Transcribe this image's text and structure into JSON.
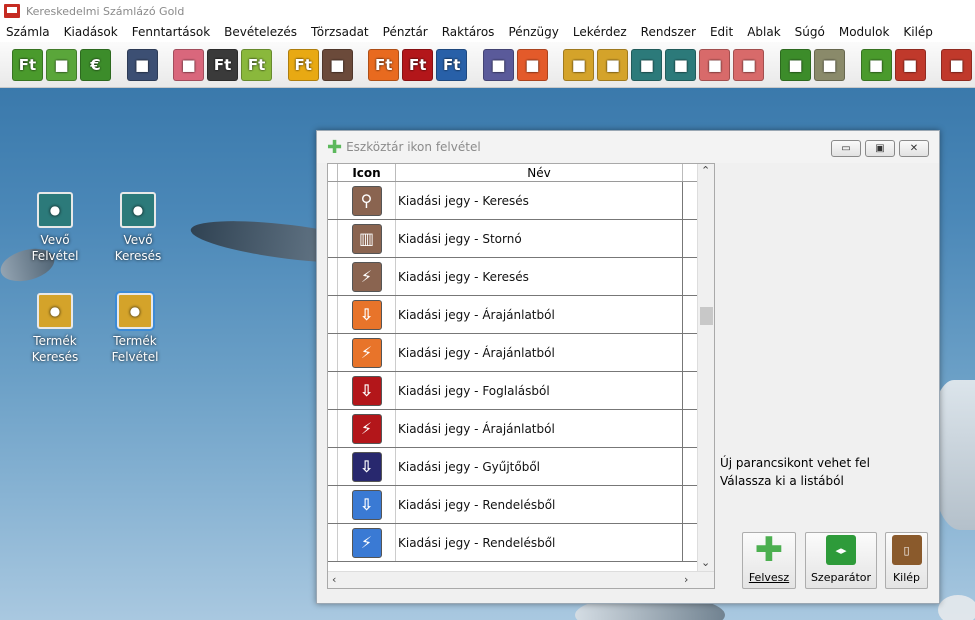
{
  "app": {
    "title": "Kereskedelmi Számlázó Gold"
  },
  "menu": [
    "Számla",
    "Kiadások",
    "Fenntartások",
    "Bevételezés",
    "Törzsadat",
    "Pénztár",
    "Raktáros",
    "Pénzügy",
    "Lekérdez",
    "Rendszer",
    "Edit",
    "Ablak",
    "Súgó",
    "Modulok",
    "Kilép"
  ],
  "toolbar": {
    "buttons": [
      {
        "icon": "forint-icon",
        "text": "Ft",
        "color": "#4a9a2c"
      },
      {
        "icon": "invoice-icon",
        "text": "",
        "color": "#5aa63a"
      },
      {
        "icon": "euro-icon",
        "text": "€",
        "color": "#3c8c2a"
      },
      {
        "icon": "gap"
      },
      {
        "icon": "printer-icon",
        "text": "",
        "color": "#3c4f73"
      },
      {
        "icon": "gap"
      },
      {
        "icon": "print-preview-icon",
        "text": "",
        "color": "#d9677c"
      },
      {
        "icon": "forint-dark-icon",
        "text": "Ft",
        "color": "#3a3a3a"
      },
      {
        "icon": "forint-green-icon",
        "text": "Ft",
        "color": "#8ab83c"
      },
      {
        "icon": "gap"
      },
      {
        "icon": "forint-yellow-icon",
        "text": "Ft",
        "color": "#e8a913"
      },
      {
        "icon": "apple-icon",
        "text": "",
        "color": "#6b4a3a"
      },
      {
        "icon": "gap"
      },
      {
        "icon": "forint-orange-icon",
        "text": "Ft",
        "color": "#e86a1f"
      },
      {
        "icon": "forint-red-icon",
        "text": "Ft",
        "color": "#b3161a"
      },
      {
        "icon": "forint-blue-icon",
        "text": "Ft",
        "color": "#2860a8"
      },
      {
        "icon": "gap"
      },
      {
        "icon": "truck-icon",
        "text": "",
        "color": "#5a5a9a"
      },
      {
        "icon": "bag-icon",
        "text": "",
        "color": "#e35a2a"
      },
      {
        "icon": "gap"
      },
      {
        "icon": "cash-register-icon",
        "text": "",
        "color": "#d4a32a"
      },
      {
        "icon": "search-icon",
        "text": "",
        "color": "#d4a32a"
      },
      {
        "icon": "user-icon",
        "text": "",
        "color": "#2c7a7a"
      },
      {
        "icon": "user-search-icon",
        "text": "",
        "color": "#2c7a7a"
      },
      {
        "icon": "tools-icon",
        "text": "",
        "color": "#d86a6a"
      },
      {
        "icon": "search-red-icon",
        "text": "",
        "color": "#d86a6a"
      },
      {
        "icon": "gap"
      },
      {
        "icon": "download-icon",
        "text": "",
        "color": "#3c8c2a"
      },
      {
        "icon": "settings-icon",
        "text": "",
        "color": "#8a8a6a"
      },
      {
        "icon": "gap"
      },
      {
        "icon": "user-in-icon",
        "text": "",
        "color": "#4a9a2c"
      },
      {
        "icon": "user-out-icon",
        "text": "",
        "color": "#c0392b"
      },
      {
        "icon": "gap"
      },
      {
        "icon": "exit-icon",
        "text": "",
        "color": "#c0392b"
      }
    ]
  },
  "desktop": {
    "icons": [
      {
        "label": "Vevő\nFelvétel",
        "icon": "user-add-icon",
        "color": "#2c7a7a"
      },
      {
        "label": "Vevő\nKeresés",
        "icon": "user-search-icon",
        "color": "#2c7a7a"
      },
      {
        "label": "Termék\nKeresés",
        "icon": "search-icon",
        "color": "#d4a32a"
      },
      {
        "label": "Termék\nFelvétel",
        "icon": "cash-register-icon",
        "color": "#d4a32a"
      }
    ]
  },
  "dialog": {
    "title": "Eszköztár ikon felvétel",
    "columns": {
      "icon": "Icon",
      "name": "Név"
    },
    "rows": [
      {
        "name": "Kiadási jegy - Keresés",
        "icon": "search-icon",
        "color": "#8a6450"
      },
      {
        "name": "Kiadási jegy - Stornó",
        "icon": "trash-icon",
        "color": "#8a6450"
      },
      {
        "name": "Kiadási jegy - Keresés",
        "icon": "lightning-icon",
        "color": "#8a6450"
      },
      {
        "name": "Kiadási jegy - Árajánlatból",
        "icon": "download-arrow-icon",
        "color": "#e8742a"
      },
      {
        "name": "Kiadási jegy - Árajánlatból",
        "icon": "lightning-icon",
        "color": "#e8742a"
      },
      {
        "name": "Kiadási jegy - Foglalásból",
        "icon": "download-arrow-icon",
        "color": "#b3161a"
      },
      {
        "name": "Kiadási jegy - Árajánlatból",
        "icon": "lightning-icon",
        "color": "#b3161a"
      },
      {
        "name": "Kiadási jegy - Gyűjtőből",
        "icon": "download-arrow-icon",
        "color": "#28286e"
      },
      {
        "name": "Kiadási jegy - Rendelésből",
        "icon": "download-arrow-icon",
        "color": "#3a7ad4"
      },
      {
        "name": "Kiadási jegy - Rendelésből",
        "icon": "lightning-icon",
        "color": "#3a7ad4"
      }
    ],
    "info_line1": "Új parancsikont vehet fel",
    "info_line2": "Válassza ki a listából",
    "buttons": {
      "add": "Felvesz",
      "separator": "Szeparátor",
      "exit": "Kilép"
    }
  }
}
